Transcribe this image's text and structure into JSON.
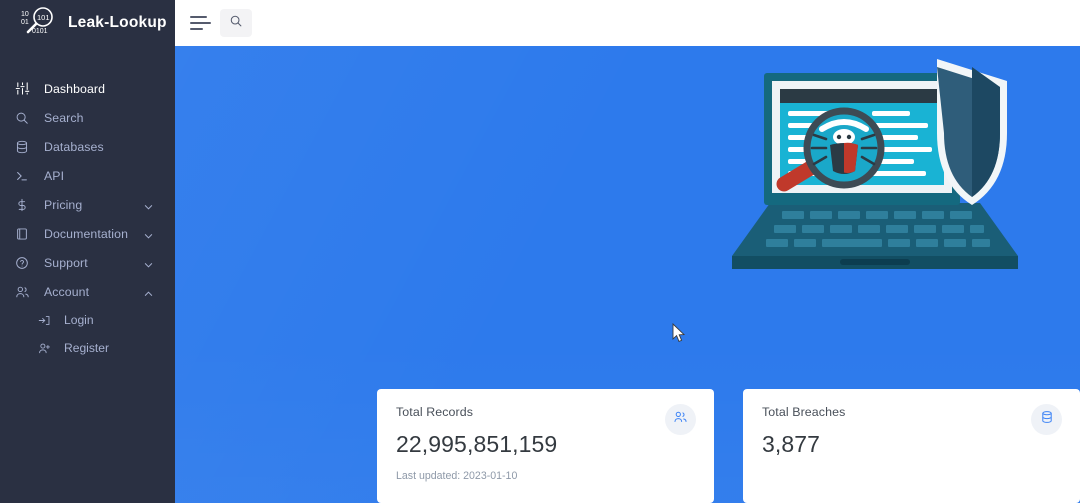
{
  "brand": {
    "name": "Leak-Lookup",
    "logo_icon": "magnifier-binary-logo"
  },
  "sidebar": {
    "items": [
      {
        "label": "Dashboard",
        "icon": "sliders-icon",
        "active": true,
        "chevron": ""
      },
      {
        "label": "Search",
        "icon": "search-icon",
        "active": false,
        "chevron": ""
      },
      {
        "label": "Databases",
        "icon": "database-icon",
        "active": false,
        "chevron": ""
      },
      {
        "label": "API",
        "icon": "terminal-icon",
        "active": false,
        "chevron": ""
      },
      {
        "label": "Pricing",
        "icon": "dollar-icon",
        "active": false,
        "chevron": "chevron-down-icon"
      },
      {
        "label": "Documentation",
        "icon": "book-icon",
        "active": false,
        "chevron": "chevron-down-icon"
      },
      {
        "label": "Support",
        "icon": "question-circle-icon",
        "active": false,
        "chevron": "chevron-down-icon"
      },
      {
        "label": "Account",
        "icon": "users-icon",
        "active": false,
        "chevron": "chevron-up-icon"
      }
    ],
    "account_children": [
      {
        "label": "Login",
        "icon": "sign-in-icon"
      },
      {
        "label": "Register",
        "icon": "user-plus-icon"
      }
    ]
  },
  "topbar": {
    "menu_icon": "hamburger-icon",
    "search_icon": "search-icon"
  },
  "main": {
    "hero_illustration": "laptop-magnifier-bug-shield-illustration",
    "cursor": "mouse-pointer"
  },
  "cards": [
    {
      "title": "Total Records",
      "value": "22,995,851,159",
      "subtitle": "Last updated: 2023-01-10",
      "badge_icon": "users-icon"
    },
    {
      "title": "Total Breaches",
      "value": "3,877",
      "subtitle": "",
      "badge_icon": "database-icon"
    }
  ],
  "colors": {
    "sidebar_bg": "#2a3042",
    "content_bg": "#2d7aec",
    "accent": "#3b82f6",
    "sidebar_text": "#a6b0cf",
    "card_value": "#343a40",
    "card_sub": "#8e99a8",
    "badge_bg": "#eff2f7"
  }
}
